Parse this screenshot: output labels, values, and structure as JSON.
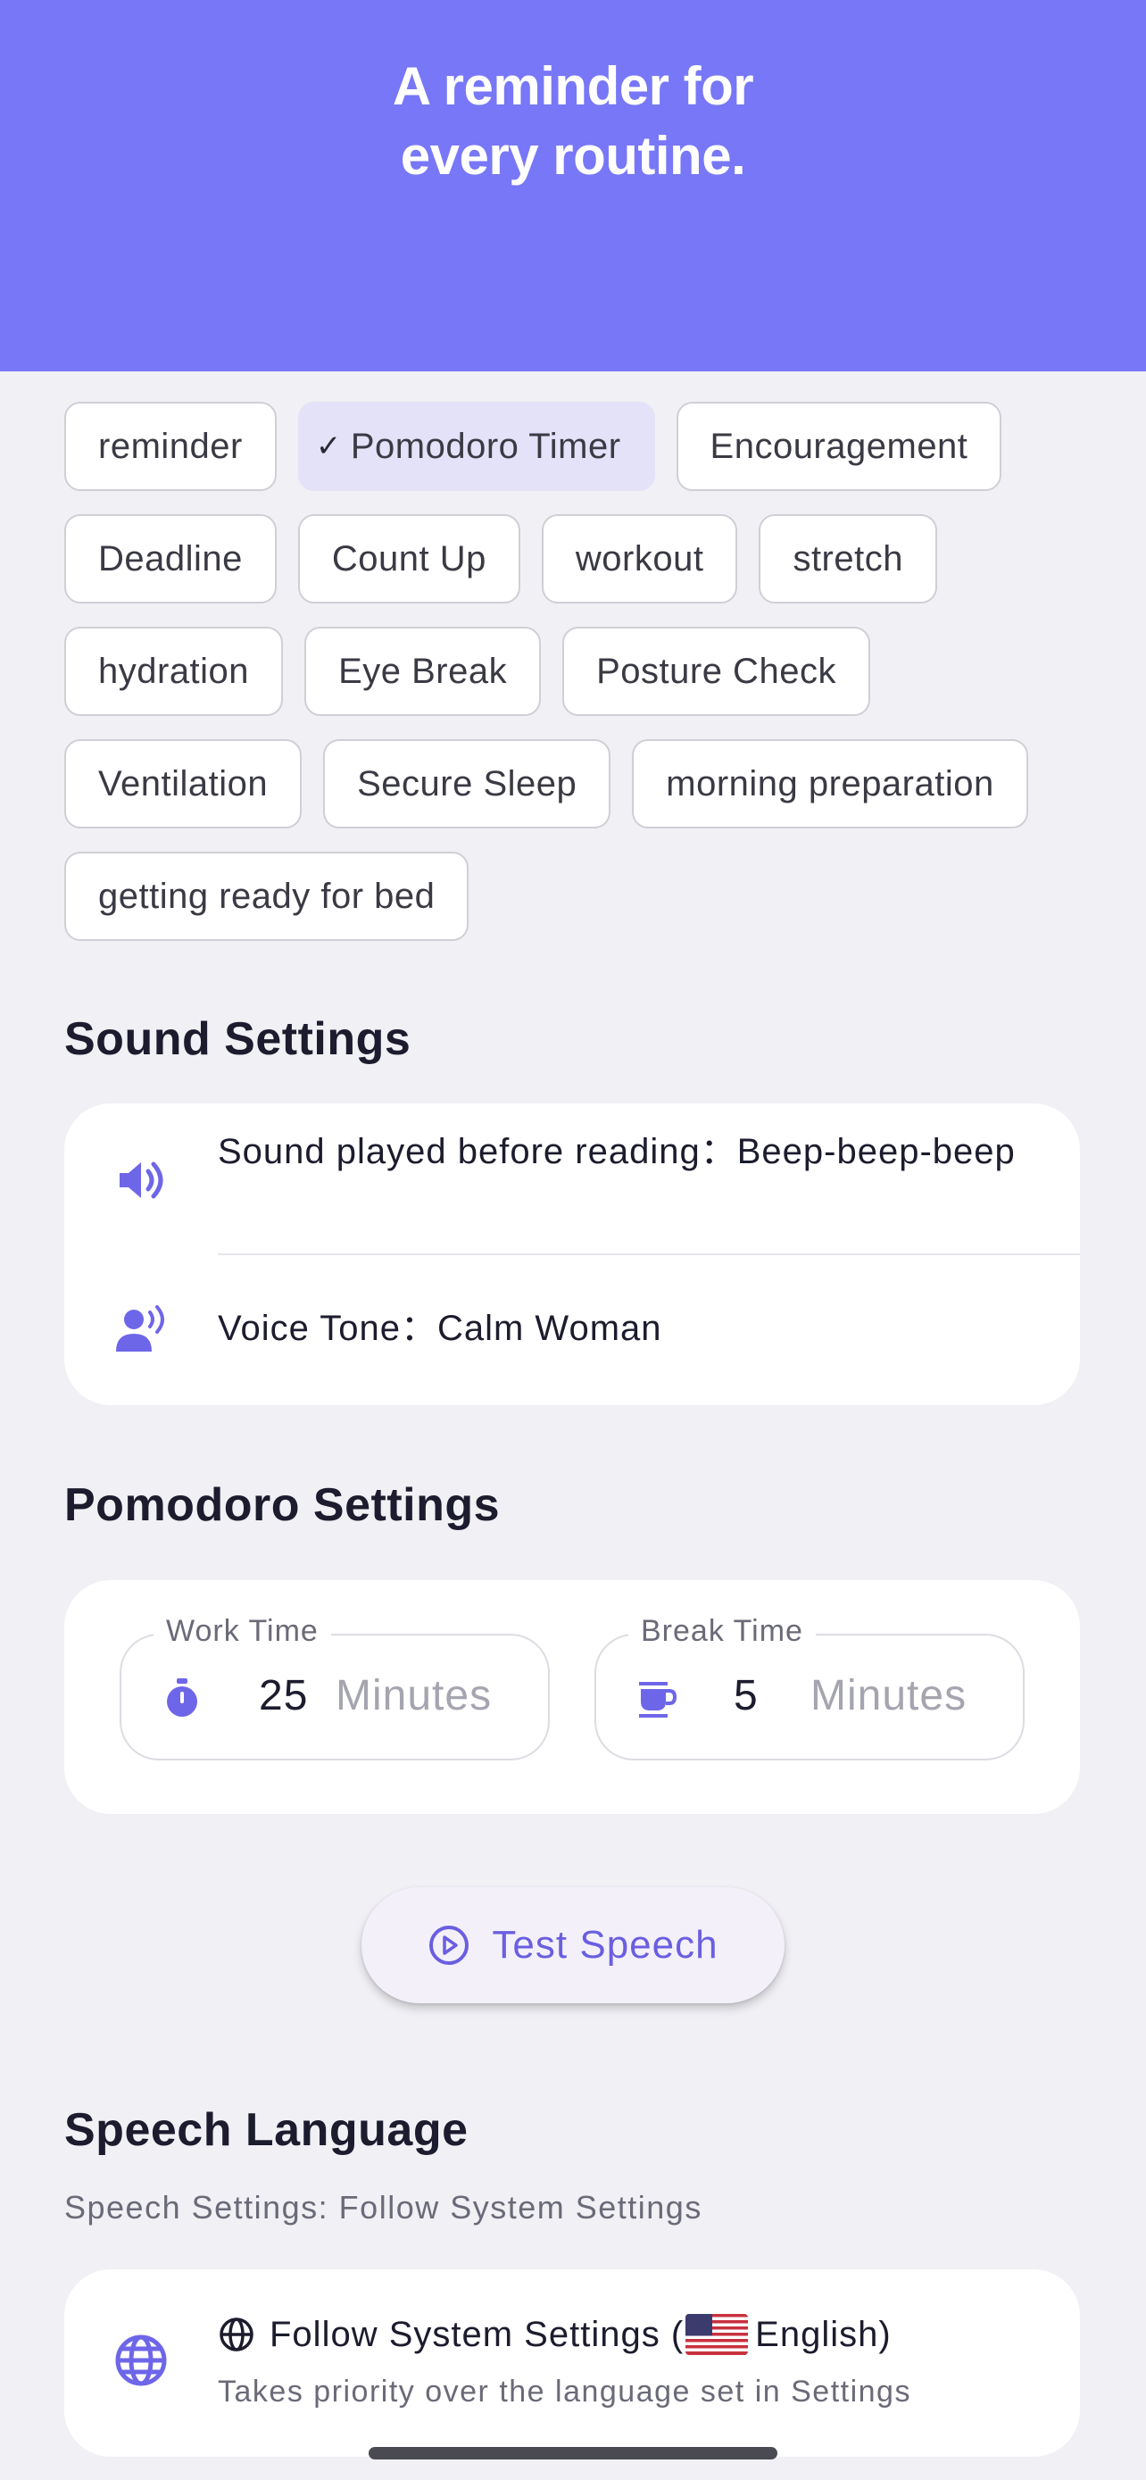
{
  "header": {
    "title": "A reminder for\nevery routine.",
    "background": "#7777f7"
  },
  "chips": [
    {
      "label": "reminder",
      "selected": false
    },
    {
      "label": "Pomodoro Timer",
      "selected": true
    },
    {
      "label": "Encouragement",
      "selected": false
    },
    {
      "label": "Deadline",
      "selected": false
    },
    {
      "label": "Count Up",
      "selected": false
    },
    {
      "label": "workout",
      "selected": false
    },
    {
      "label": "stretch",
      "selected": false
    },
    {
      "label": "hydration",
      "selected": false
    },
    {
      "label": "Eye Break",
      "selected": false
    },
    {
      "label": "Posture Check",
      "selected": false
    },
    {
      "label": "Ventilation",
      "selected": false
    },
    {
      "label": "Secure Sleep",
      "selected": false
    },
    {
      "label": "morning preparation",
      "selected": false
    },
    {
      "label": "getting ready for bed",
      "selected": false
    }
  ],
  "sound_settings": {
    "title": "Sound Settings",
    "before_reading": "Sound played before reading：Beep-beep-beep",
    "before_reading_icon": "speaker-icon",
    "voice_tone": "Voice Tone：Calm Woman",
    "voice_tone_icon": "voice-person-icon"
  },
  "pomodoro_settings": {
    "title": "Pomodoro Settings",
    "work": {
      "label": "Work Time",
      "value": "25",
      "unit": "Minutes",
      "icon": "stopwatch-icon"
    },
    "break": {
      "label": "Break Time",
      "value": "5",
      "unit": "Minutes",
      "icon": "coffee-cup-icon"
    }
  },
  "test_speech": {
    "label": "Test Speech",
    "icon": "play-circle-icon"
  },
  "speech_language": {
    "title": "Speech Language",
    "subtitle": "Speech Settings: Follow System Settings",
    "option_prefix": "Follow System Settings (",
    "option_language": "English)",
    "option_note": "Takes priority over the language set in Settings",
    "globe_icon": "globe-icon",
    "flag_icon": "us-flag-icon"
  },
  "colors": {
    "accent": "#6a5fe0",
    "icon": "#6e66e8",
    "chip_selected": "#e3e2f8",
    "background": "#f0f0f5"
  }
}
